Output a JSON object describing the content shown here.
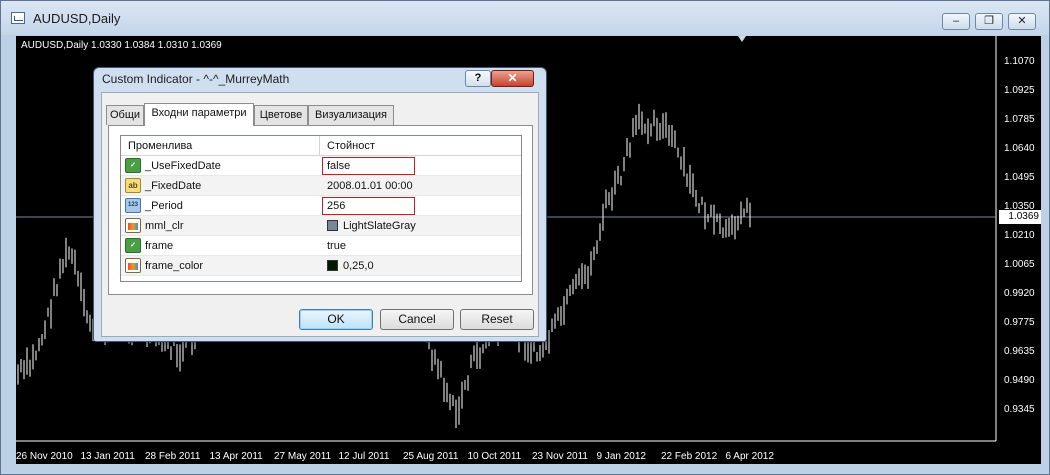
{
  "window": {
    "title": "AUDUSD,Daily",
    "minimize_glyph": "–",
    "restore_glyph": "❐",
    "close_glyph": "✕"
  },
  "chart": {
    "info_line": "AUDUSD,Daily  1.0330 1.0384 1.0310 1.0369",
    "current_price": "1.0369",
    "price_axis": [
      "1.1070",
      "1.0925",
      "1.0785",
      "1.0640",
      "1.0495",
      "1.0350",
      "1.0210",
      "1.0065",
      "0.9920",
      "0.9775",
      "0.9635",
      "0.9490",
      "0.9345"
    ],
    "date_axis": [
      "26 Nov 2010",
      "13 Jan 2011",
      "28 Feb 2011",
      "13 Apr 2011",
      "27 May 2011",
      "12 Jul 2011",
      "25 Aug 2011",
      "10 Oct 2011",
      "23 Nov 2011",
      "9 Jan 2012",
      "22 Feb 2012",
      "6 Apr 2012"
    ],
    "colors": {
      "background": "#000000",
      "bars": "#ffffff",
      "grid_line": "#7f8a9a"
    }
  },
  "dialog": {
    "title": "Custom Indicator - ^-^_MurreyMath",
    "help_glyph": "?",
    "close_glyph": "✕",
    "tabs": [
      {
        "label": "Общи",
        "active": false
      },
      {
        "label": "Входни параметри",
        "active": true
      },
      {
        "label": "Цветове",
        "active": false
      },
      {
        "label": "Визуализация",
        "active": false
      }
    ],
    "columns": {
      "variable": "Променлива",
      "value": "Стойност"
    },
    "rows": [
      {
        "icon": "bool-icon",
        "name": "_UseFixedDate",
        "value": "false",
        "highlighted": true
      },
      {
        "icon": "string-icon",
        "name": "_FixedDate",
        "value": "2008.01.01 00:00",
        "highlighted": false
      },
      {
        "icon": "int-icon",
        "name": "_Period",
        "value": "256",
        "highlighted": true
      },
      {
        "icon": "color-icon",
        "name": "mml_clr",
        "value": "LightSlateGray",
        "swatch": "#778899",
        "highlighted": false
      },
      {
        "icon": "bool-icon",
        "name": "frame",
        "value": "true",
        "highlighted": false
      },
      {
        "icon": "color-icon",
        "name": "frame_color",
        "value": "0,25,0",
        "swatch": "#001900",
        "highlighted": false
      }
    ],
    "icon_text": {
      "bool": "✓",
      "string": "ab",
      "int": "123"
    },
    "buttons": {
      "ok": "OK",
      "cancel": "Cancel",
      "reset": "Reset"
    }
  }
}
